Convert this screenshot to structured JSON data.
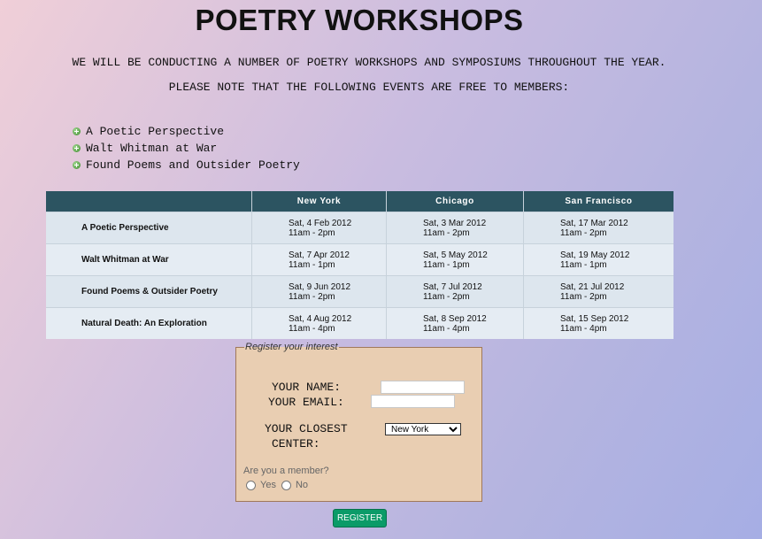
{
  "page": {
    "title": "POETRY WORKSHOPS",
    "intro_line1": "WE WILL BE CONDUCTING A NUMBER OF POETRY WORKSHOPS AND SYMPOSIUMS THROUGHOUT THE YEAR.",
    "intro_line2": "PLEASE NOTE THAT THE FOLLOWING EVENTS ARE FREE TO MEMBERS:"
  },
  "free_events": [
    "A Poetic Perspective",
    "Walt Whitman at War",
    "Found Poems and Outsider Poetry"
  ],
  "schedule": {
    "headers": [
      "",
      "New York",
      "Chicago",
      "San Francisco"
    ],
    "rows": [
      {
        "event": "A Poetic Perspective",
        "slots": [
          {
            "date": "Sat, 4 Feb 2012",
            "time": "11am - 2pm"
          },
          {
            "date": "Sat, 3 Mar 2012",
            "time": "11am - 2pm"
          },
          {
            "date": "Sat, 17 Mar 2012",
            "time": "11am - 2pm"
          }
        ]
      },
      {
        "event": "Walt Whitman at War",
        "slots": [
          {
            "date": "Sat, 7 Apr 2012",
            "time": "11am - 1pm"
          },
          {
            "date": "Sat, 5 May 2012",
            "time": "11am - 1pm"
          },
          {
            "date": "Sat, 19 May 2012",
            "time": "11am - 1pm"
          }
        ]
      },
      {
        "event": "Found Poems & Outsider Poetry",
        "slots": [
          {
            "date": "Sat, 9 Jun 2012",
            "time": "11am - 2pm"
          },
          {
            "date": "Sat, 7 Jul 2012",
            "time": "11am - 2pm"
          },
          {
            "date": "Sat, 21 Jul 2012",
            "time": "11am - 2pm"
          }
        ]
      },
      {
        "event": "Natural Death: An Exploration",
        "slots": [
          {
            "date": "Sat, 4 Aug 2012",
            "time": "11am - 4pm"
          },
          {
            "date": "Sat, 8 Sep 2012",
            "time": "11am - 4pm"
          },
          {
            "date": "Sat, 15 Sep 2012",
            "time": "11am - 4pm"
          }
        ]
      }
    ]
  },
  "form": {
    "legend": "Register your interest",
    "name_label": "YOUR NAME:",
    "name_value": "",
    "email_label": "YOUR EMAIL:",
    "email_value": "",
    "center_label_line1": "YOUR CLOSEST",
    "center_label_line2": "CENTER:",
    "center_selected": "New York",
    "member_question": "Are you a member?",
    "member_yes": "Yes",
    "member_no": "No",
    "submit_label": "REGISTER"
  },
  "colors": {
    "table_header_bg": "#2c5461",
    "form_bg": "#e9ceb2",
    "register_button": "#0b9b68",
    "bullet_icon": "#5aa04a"
  },
  "icons": {
    "bullet": "plus-circle-icon",
    "select_arrow": "chevron-down-icon"
  }
}
